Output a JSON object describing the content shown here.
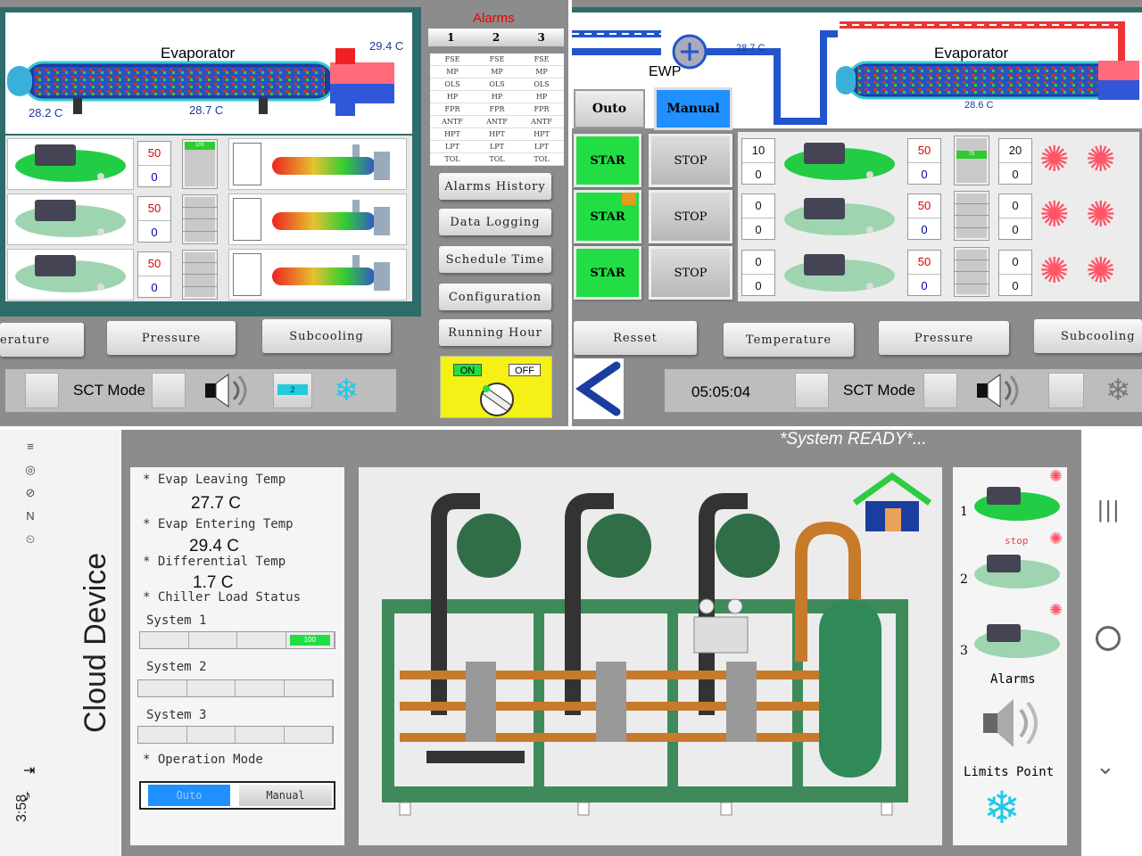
{
  "panel_left": {
    "title": "Evaporator",
    "temp_top_right": "29.4 C",
    "temp_left": "28.2 C",
    "temp_mid": "28.7 C",
    "compressors": [
      {
        "top": "50",
        "bottom": "0",
        "load": "100"
      },
      {
        "top": "50",
        "bottom": "0",
        "load": ""
      },
      {
        "top": "50",
        "bottom": "0",
        "load": ""
      }
    ],
    "tabs": [
      "erature",
      "Pressure",
      "Subcooling"
    ],
    "footer": {
      "sct_mode": "SCT Mode",
      "small_value": "2"
    }
  },
  "alarms": {
    "title": "Alarms",
    "columns": [
      "1",
      "2",
      "3"
    ],
    "rows": [
      [
        "FSE",
        "FSE",
        "FSE"
      ],
      [
        "MP",
        "MP",
        "MP"
      ],
      [
        "OLS",
        "OLS",
        "OLS"
      ],
      [
        "HP",
        "HP",
        "HP"
      ],
      [
        "FPR",
        "FPR",
        "FPR"
      ],
      [
        "ANTF",
        "ANTF",
        "ANTF"
      ],
      [
        "HPT",
        "HPT",
        "HPT"
      ],
      [
        "LPT",
        "LPT",
        "LPT"
      ],
      [
        "TOL",
        "TOL",
        "TOL"
      ]
    ],
    "menu": [
      "Alarms History",
      "Data Logging",
      "Schedule Time",
      "Configuration",
      "Running Hour"
    ],
    "switch_on": "ON",
    "switch_off": "OFF"
  },
  "panel_right": {
    "title": "Evaporator",
    "pump_label": "EWP",
    "temp_pipe": "28.7 C",
    "temp_evap": "28.6 C",
    "mode_auto": "Outo",
    "mode_manual": "Manual",
    "start_label": "STAR",
    "stop_label": "STOP",
    "rows": [
      {
        "left_top": "10",
        "left_bottom": "0",
        "right_top": "50",
        "right_bottom": "0",
        "load": "75",
        "fan_top": "20",
        "fan_bottom": "0"
      },
      {
        "left_top": "0",
        "left_bottom": "0",
        "right_top": "50",
        "right_bottom": "0",
        "load": "",
        "fan_top": "0",
        "fan_bottom": "0"
      },
      {
        "left_top": "0",
        "left_bottom": "0",
        "right_top": "50",
        "right_bottom": "0",
        "load": "",
        "fan_top": "0",
        "fan_bottom": "0"
      }
    ],
    "tabs": [
      "Resset",
      "Temperature",
      "Pressure",
      "Subcooling"
    ],
    "clock": "05:05:04",
    "sct_mode": "SCT Mode"
  },
  "mobile": {
    "side_title": "Cloud Device",
    "status_time": "3:58",
    "system_status": "*System READY*...",
    "readings": [
      {
        "label": "* Evap Leaving Temp",
        "value": "27.7 C"
      },
      {
        "label": "* Evap Entering Temp",
        "value": "29.4 C"
      },
      {
        "label": "* Differential Temp",
        "value": "1.7 C"
      }
    ],
    "load_status_label": "* Chiller Load Status",
    "systems": [
      {
        "label": "System 1",
        "load": "100"
      },
      {
        "label": "System 2",
        "load": ""
      },
      {
        "label": "System 3",
        "load": ""
      }
    ],
    "operation_mode_label": "* Operation Mode",
    "mode_auto": "Outo",
    "mode_manual": "Manual",
    "compressor_list": [
      {
        "num": "1",
        "status": ""
      },
      {
        "num": "2",
        "status": "stop"
      },
      {
        "num": "3",
        "status": ""
      }
    ],
    "alarms_label": "Alarms",
    "limits_label": "Limits Point"
  },
  "colors": {
    "panel_bg": "#8c8c8c",
    "teal_frame": "#2e6b6b",
    "green_on": "#22dd44",
    "blue_btn": "#1e90ff",
    "pump_blue": "#2255cc"
  }
}
